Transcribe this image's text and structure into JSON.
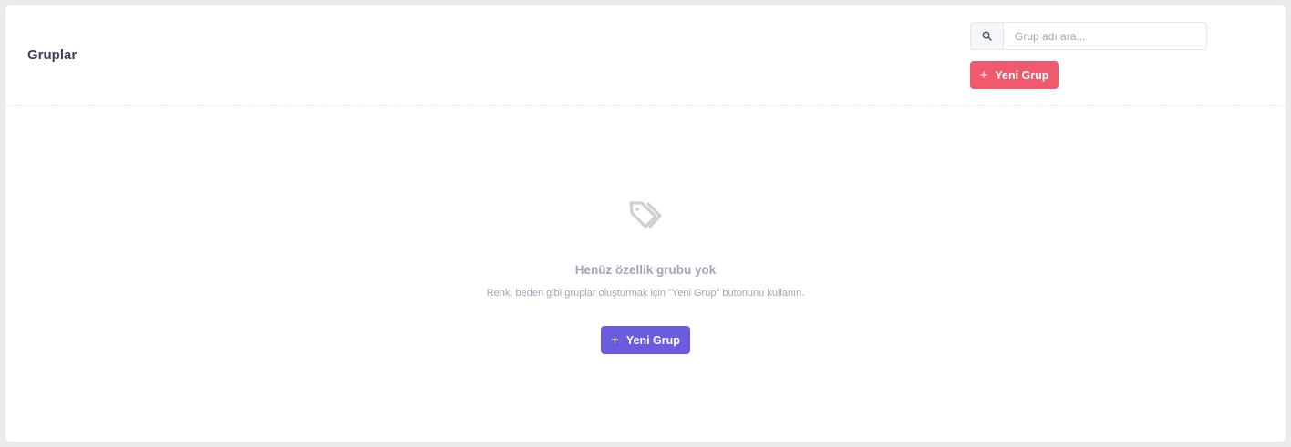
{
  "header": {
    "title": "Gruplar"
  },
  "search": {
    "placeholder": "Grup adı ara...",
    "value": ""
  },
  "toolbar": {
    "new_group_label": "Yeni Grup"
  },
  "empty_state": {
    "icon": "tags-icon",
    "title": "Henüz özellik grubu yok",
    "description": "Renk, beden gibi gruplar oluşturmak için \"Yeni Grup\" butonunu kullanın.",
    "button_label": "Yeni Grup"
  },
  "colors": {
    "danger": "#f1596f",
    "primary": "#6a5bdf",
    "muted_text": "#a1a5b7",
    "title_text": "#3f4254"
  }
}
